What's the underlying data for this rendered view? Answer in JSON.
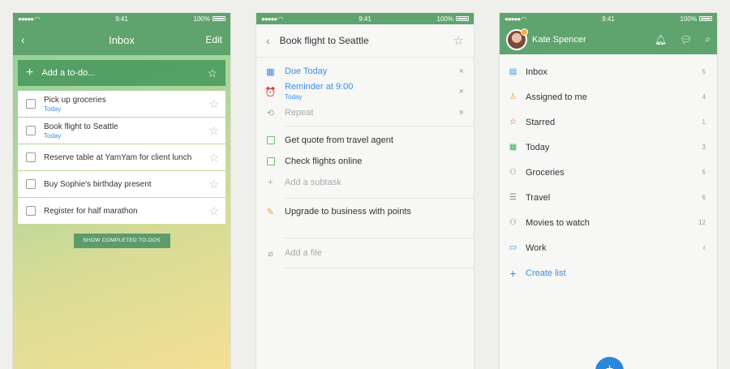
{
  "status": {
    "time": "9:41",
    "battery": "100%"
  },
  "inbox": {
    "title": "Inbox",
    "edit_label": "Edit",
    "add_placeholder": "Add a to-do...",
    "todos": [
      {
        "name": "Pick up groceries",
        "due": "Today"
      },
      {
        "name": "Book flight to Seattle",
        "due": "Today"
      },
      {
        "name": "Reserve table at YamYam for client lunch",
        "due": ""
      },
      {
        "name": "Buy Sophie's birthday present",
        "due": ""
      },
      {
        "name": "Register for half marathon",
        "due": ""
      }
    ],
    "show_completed": "SHOW COMPLETED TO-DOS"
  },
  "detail": {
    "title": "Book flight to Seattle",
    "due": "Due Today",
    "reminder": "Reminder at 9:00",
    "reminder_sub": "Today",
    "repeat": "Repeat",
    "subtasks": [
      "Get quote from travel agent",
      "Check flights online"
    ],
    "add_subtask": "Add a subtask",
    "note": "Upgrade to business with points",
    "add_file": "Add a file"
  },
  "lists": {
    "user": "Kate Spencer",
    "items": [
      {
        "label": "Inbox",
        "count": "5",
        "icon": "inbox-icon"
      },
      {
        "label": "Assigned to me",
        "count": "4",
        "icon": "person-icon"
      },
      {
        "label": "Starred",
        "count": "1",
        "icon": "star-icon"
      },
      {
        "label": "Today",
        "count": "3",
        "icon": "calendar-icon"
      },
      {
        "label": "Groceries",
        "count": "5",
        "icon": "shared-people-icon"
      },
      {
        "label": "Travel",
        "count": "6",
        "icon": "list-icon"
      },
      {
        "label": "Movies to watch",
        "count": "12",
        "icon": "shared-people-icon"
      },
      {
        "label": "Work",
        "count": "",
        "icon": "folder-icon"
      }
    ],
    "create_list": "Create list"
  },
  "colors": {
    "green": "#5fa36e",
    "blue": "#3a8ee6",
    "fab": "#2b88d8"
  }
}
